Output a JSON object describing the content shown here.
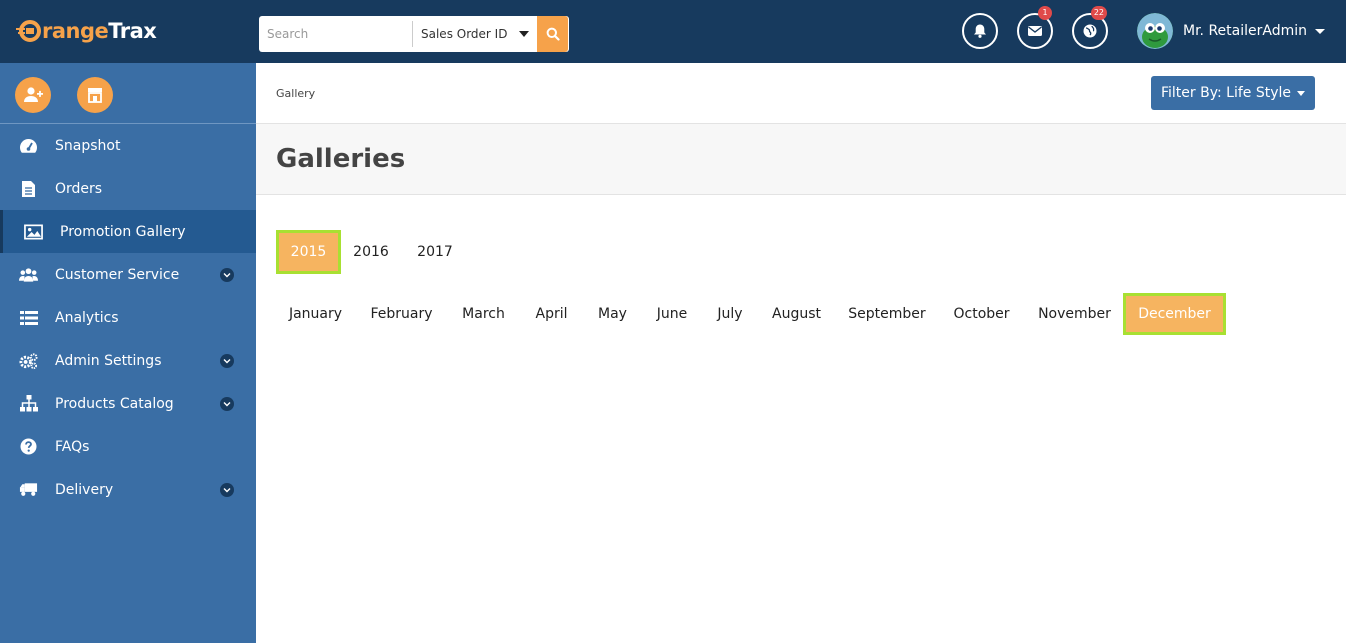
{
  "app": {
    "logo_prefix": "O",
    "logo_name_orange": "range",
    "logo_name_white": "Trax"
  },
  "search": {
    "placeholder": "Search",
    "type_selected": "Sales Order ID"
  },
  "notifications": {
    "messages_count": "1",
    "globe_count": "22"
  },
  "user": {
    "name": "Mr. RetailerAdmin"
  },
  "sidebar": {
    "items": [
      {
        "label": "Snapshot",
        "icon": "dashboard-icon"
      },
      {
        "label": "Orders",
        "icon": "document-icon"
      },
      {
        "label": "Promotion Gallery",
        "icon": "image-icon",
        "active": true
      },
      {
        "label": "Customer Service",
        "icon": "users-icon",
        "expandable": true
      },
      {
        "label": "Analytics",
        "icon": "list-icon"
      },
      {
        "label": "Admin Settings",
        "icon": "gears-icon",
        "expandable": true
      },
      {
        "label": "Products Catalog",
        "icon": "sitemap-icon",
        "expandable": true
      },
      {
        "label": "FAQs",
        "icon": "question-icon"
      },
      {
        "label": "Delivery",
        "icon": "truck-icon",
        "expandable": true
      }
    ]
  },
  "header": {
    "breadcrumb": "Gallery",
    "filter_label": "Filter By: Life Style",
    "title": "Galleries"
  },
  "years": {
    "items": [
      "2015",
      "2016",
      "2017"
    ],
    "selected": "2015"
  },
  "months": {
    "items": [
      "January",
      "February",
      "March",
      "April",
      "May",
      "June",
      "July",
      "August",
      "September",
      "October",
      "November",
      "December"
    ],
    "selected": "December"
  },
  "colors": {
    "topbar": "#173a5e",
    "sidebar": "#3a6ea5",
    "accent": "#f6a24a",
    "selected_border": "#a8e032"
  }
}
